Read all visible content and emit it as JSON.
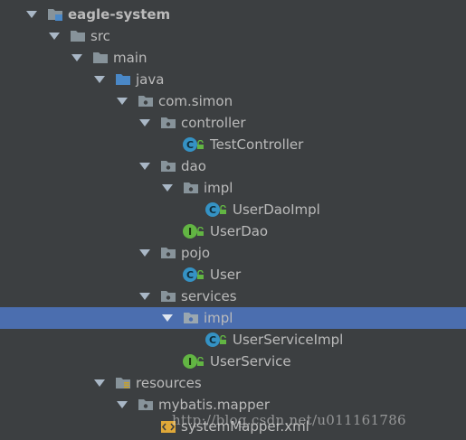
{
  "project_tree": {
    "rows": [
      {
        "label": "eagle-system",
        "kind": "module",
        "expanded": true,
        "selected": false
      },
      {
        "label": "src",
        "kind": "folder",
        "expanded": true,
        "selected": false
      },
      {
        "label": "main",
        "kind": "folder",
        "expanded": true,
        "selected": false
      },
      {
        "label": "java",
        "kind": "source-folder",
        "expanded": true,
        "selected": false
      },
      {
        "label": "com.simon",
        "kind": "package",
        "expanded": true,
        "selected": false
      },
      {
        "label": "controller",
        "kind": "package",
        "expanded": true,
        "selected": false
      },
      {
        "label": "TestController",
        "kind": "class",
        "selected": false
      },
      {
        "label": "dao",
        "kind": "package",
        "expanded": true,
        "selected": false
      },
      {
        "label": "impl",
        "kind": "package",
        "expanded": true,
        "selected": false
      },
      {
        "label": "UserDaoImpl",
        "kind": "class",
        "selected": false
      },
      {
        "label": "UserDao",
        "kind": "interface",
        "selected": false
      },
      {
        "label": "pojo",
        "kind": "package",
        "expanded": true,
        "selected": false
      },
      {
        "label": "User",
        "kind": "class",
        "selected": false
      },
      {
        "label": "services",
        "kind": "package",
        "expanded": true,
        "selected": false
      },
      {
        "label": "impl",
        "kind": "package",
        "expanded": true,
        "selected": true
      },
      {
        "label": "UserServiceImpl",
        "kind": "class",
        "selected": false
      },
      {
        "label": "UserService",
        "kind": "interface",
        "selected": false
      },
      {
        "label": "resources",
        "kind": "resources-folder",
        "expanded": true,
        "selected": false
      },
      {
        "label": "mybatis.mapper",
        "kind": "package",
        "expanded": true,
        "selected": false
      },
      {
        "label": "systemMapper.xml",
        "kind": "xml-file",
        "selected": false
      }
    ],
    "class_badge": "C",
    "interface_badge": "I"
  },
  "watermark": "http://blog.csdn.net/u011161786",
  "colors": {
    "background": "#3c3f41",
    "selection": "#4b6eaf",
    "text": "#bbbbbb",
    "class_icon": "#3592c4",
    "interface_icon": "#62b543",
    "folder": "#87939a",
    "source_folder": "#4a88c7"
  }
}
